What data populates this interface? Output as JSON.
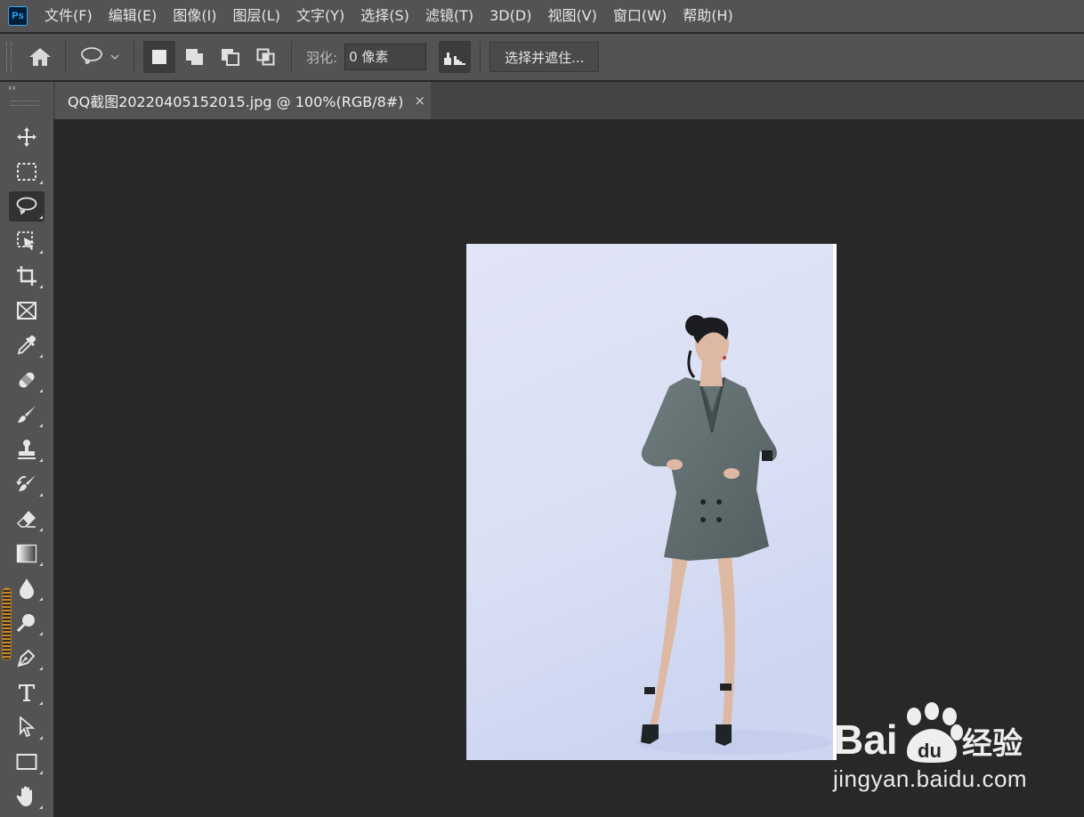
{
  "app": {
    "logo": "Ps"
  },
  "menu": [
    "文件(F)",
    "编辑(E)",
    "图像(I)",
    "图层(L)",
    "文字(Y)",
    "选择(S)",
    "滤镜(T)",
    "3D(D)",
    "视图(V)",
    "窗口(W)",
    "帮助(H)"
  ],
  "options": {
    "feather_label": "羽化:",
    "feather_value": "0 像素",
    "select_and_mask": "选择并遮住..."
  },
  "toolbar": {
    "collapse": "››",
    "tools": [
      "move-icon",
      "marquee-icon",
      "lasso-icon",
      "object-select-icon",
      "crop-icon",
      "frame-icon",
      "eyedropper-icon",
      "healing-icon",
      "brush-icon",
      "stamp-icon",
      "history-brush-icon",
      "eraser-icon",
      "gradient-icon",
      "blur-icon",
      "dodge-icon",
      "pen-icon",
      "type-icon",
      "path-select-icon",
      "rectangle-icon",
      "hand-icon"
    ],
    "active_tool": "lasso-icon"
  },
  "document": {
    "tab_title": "QQ截图20220405152015.jpg @ 100%(RGB/8#)",
    "close": "×"
  },
  "watermark": {
    "brand": "Bai du 经验",
    "url": "jingyan.baidu.com"
  },
  "colors": {
    "ui_bg": "#535353",
    "canvas_bg": "#282828",
    "photo_bg": "#dfe3f6",
    "ps_blue": "#31a8ff"
  }
}
